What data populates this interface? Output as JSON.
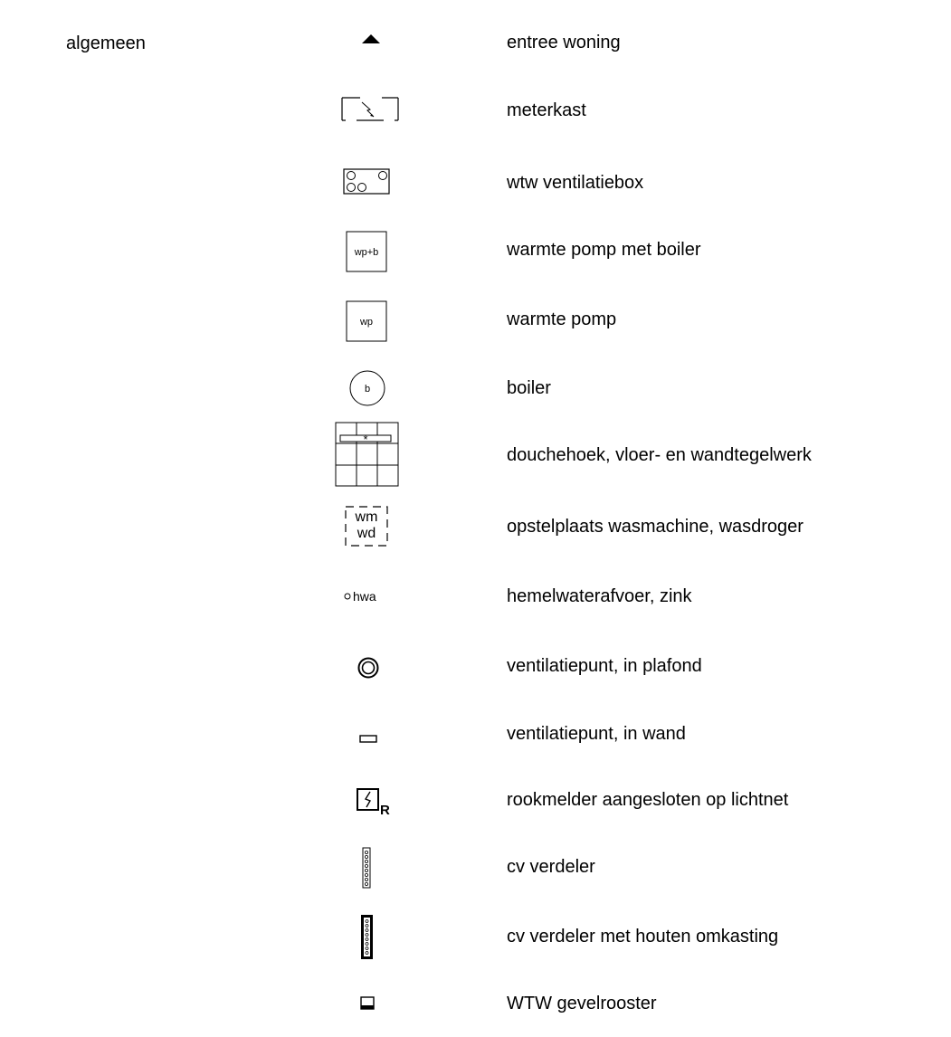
{
  "section": {
    "title": "algemeen"
  },
  "legend": [
    {
      "icon": "entrance-triangle-icon",
      "label": "entree woning"
    },
    {
      "icon": "meter-cabinet-icon",
      "label": "meterkast"
    },
    {
      "icon": "ventilation-box-icon",
      "label": "wtw ventilatiebox"
    },
    {
      "icon": "heat-pump-boiler-icon",
      "icon_text": "wp+b",
      "label": "warmte pomp met boiler"
    },
    {
      "icon": "heat-pump-icon",
      "icon_text": "wp",
      "label": "warmte pomp"
    },
    {
      "icon": "boiler-icon",
      "icon_text": "b",
      "label": "boiler"
    },
    {
      "icon": "shower-tiles-icon",
      "label": "douchehoek, vloer- en wandtegelwerk"
    },
    {
      "icon": "washing-machine-spot-icon",
      "icon_text": [
        "wm",
        "wd"
      ],
      "label": "opstelplaats wasmachine, wasdroger"
    },
    {
      "icon": "rainwater-drain-icon",
      "icon_text": "hwa",
      "label": "hemelwaterafvoer, zink"
    },
    {
      "icon": "ceiling-vent-icon",
      "label": "ventilatiepunt, in plafond"
    },
    {
      "icon": "wall-vent-icon",
      "label": "ventilatiepunt, in wand"
    },
    {
      "icon": "smoke-detector-icon",
      "icon_text": "R",
      "label": "rookmelder aangesloten op lichtnet"
    },
    {
      "icon": "cv-manifold-icon",
      "label": "cv verdeler"
    },
    {
      "icon": "cv-manifold-cased-icon",
      "label": "cv verdeler met houten omkasting"
    },
    {
      "icon": "facade-grille-icon",
      "label": "WTW gevelrooster"
    }
  ]
}
